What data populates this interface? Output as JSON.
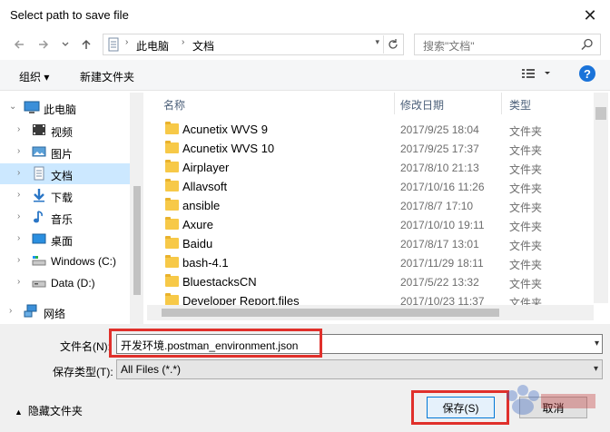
{
  "window": {
    "title": "Select path to save file",
    "close_glyph": "✕"
  },
  "nav": {
    "back_icon": "back-arrow-icon",
    "forward_icon": "forward-arrow-icon",
    "recent_icon": "chevron-down-icon",
    "up_icon": "up-arrow-icon",
    "breadcrumb": [
      "此电脑",
      "文档"
    ],
    "search_placeholder": "搜索\"文档\""
  },
  "toolbar": {
    "organize": "组织 ▾",
    "new_folder": "新建文件夹",
    "help": "?"
  },
  "sidebar": {
    "items": [
      {
        "label": "此电脑",
        "icon": "computer-icon",
        "expanded": true
      },
      {
        "label": "视频",
        "icon": "video-folder-icon"
      },
      {
        "label": "图片",
        "icon": "pictures-folder-icon"
      },
      {
        "label": "文档",
        "icon": "documents-folder-icon",
        "selected": true
      },
      {
        "label": "下载",
        "icon": "downloads-folder-icon"
      },
      {
        "label": "音乐",
        "icon": "music-folder-icon"
      },
      {
        "label": "桌面",
        "icon": "desktop-folder-icon"
      },
      {
        "label": "Windows (C:)",
        "icon": "drive-c-icon"
      },
      {
        "label": "Data (D:)",
        "icon": "drive-d-icon"
      },
      {
        "label": "网络",
        "icon": "network-icon"
      }
    ]
  },
  "columns": {
    "name": "名称",
    "date": "修改日期",
    "type": "类型"
  },
  "files": [
    {
      "name": "Acunetix WVS 9",
      "date": "2017/9/25 18:04",
      "type": "文件夹"
    },
    {
      "name": "Acunetix WVS 10",
      "date": "2017/9/25 17:37",
      "type": "文件夹"
    },
    {
      "name": "Airplayer",
      "date": "2017/8/10 21:13",
      "type": "文件夹"
    },
    {
      "name": "Allavsoft",
      "date": "2017/10/16 11:26",
      "type": "文件夹"
    },
    {
      "name": "ansible",
      "date": "2017/8/7 17:10",
      "type": "文件夹"
    },
    {
      "name": "Axure",
      "date": "2017/10/10 19:11",
      "type": "文件夹"
    },
    {
      "name": "Baidu",
      "date": "2017/8/17 13:01",
      "type": "文件夹"
    },
    {
      "name": "bash-4.1",
      "date": "2017/11/29 18:11",
      "type": "文件夹"
    },
    {
      "name": "BluestacksCN",
      "date": "2017/5/22 13:32",
      "type": "文件夹"
    },
    {
      "name": "Developer Report.files",
      "date": "2017/10/23 11:37",
      "type": "文件夹"
    }
  ],
  "form": {
    "filename_label": "文件名(N):",
    "filename_value": "开发环境.postman_environment.json",
    "filetype_label": "保存类型(T):",
    "filetype_value": "All Files (*.*)"
  },
  "footer": {
    "hide_folders": "隐藏文件夹",
    "save": "保存(S)",
    "cancel": "取消"
  },
  "colors": {
    "highlight": "#e0302b",
    "selection": "#cce8ff",
    "accent": "#0078d7"
  }
}
